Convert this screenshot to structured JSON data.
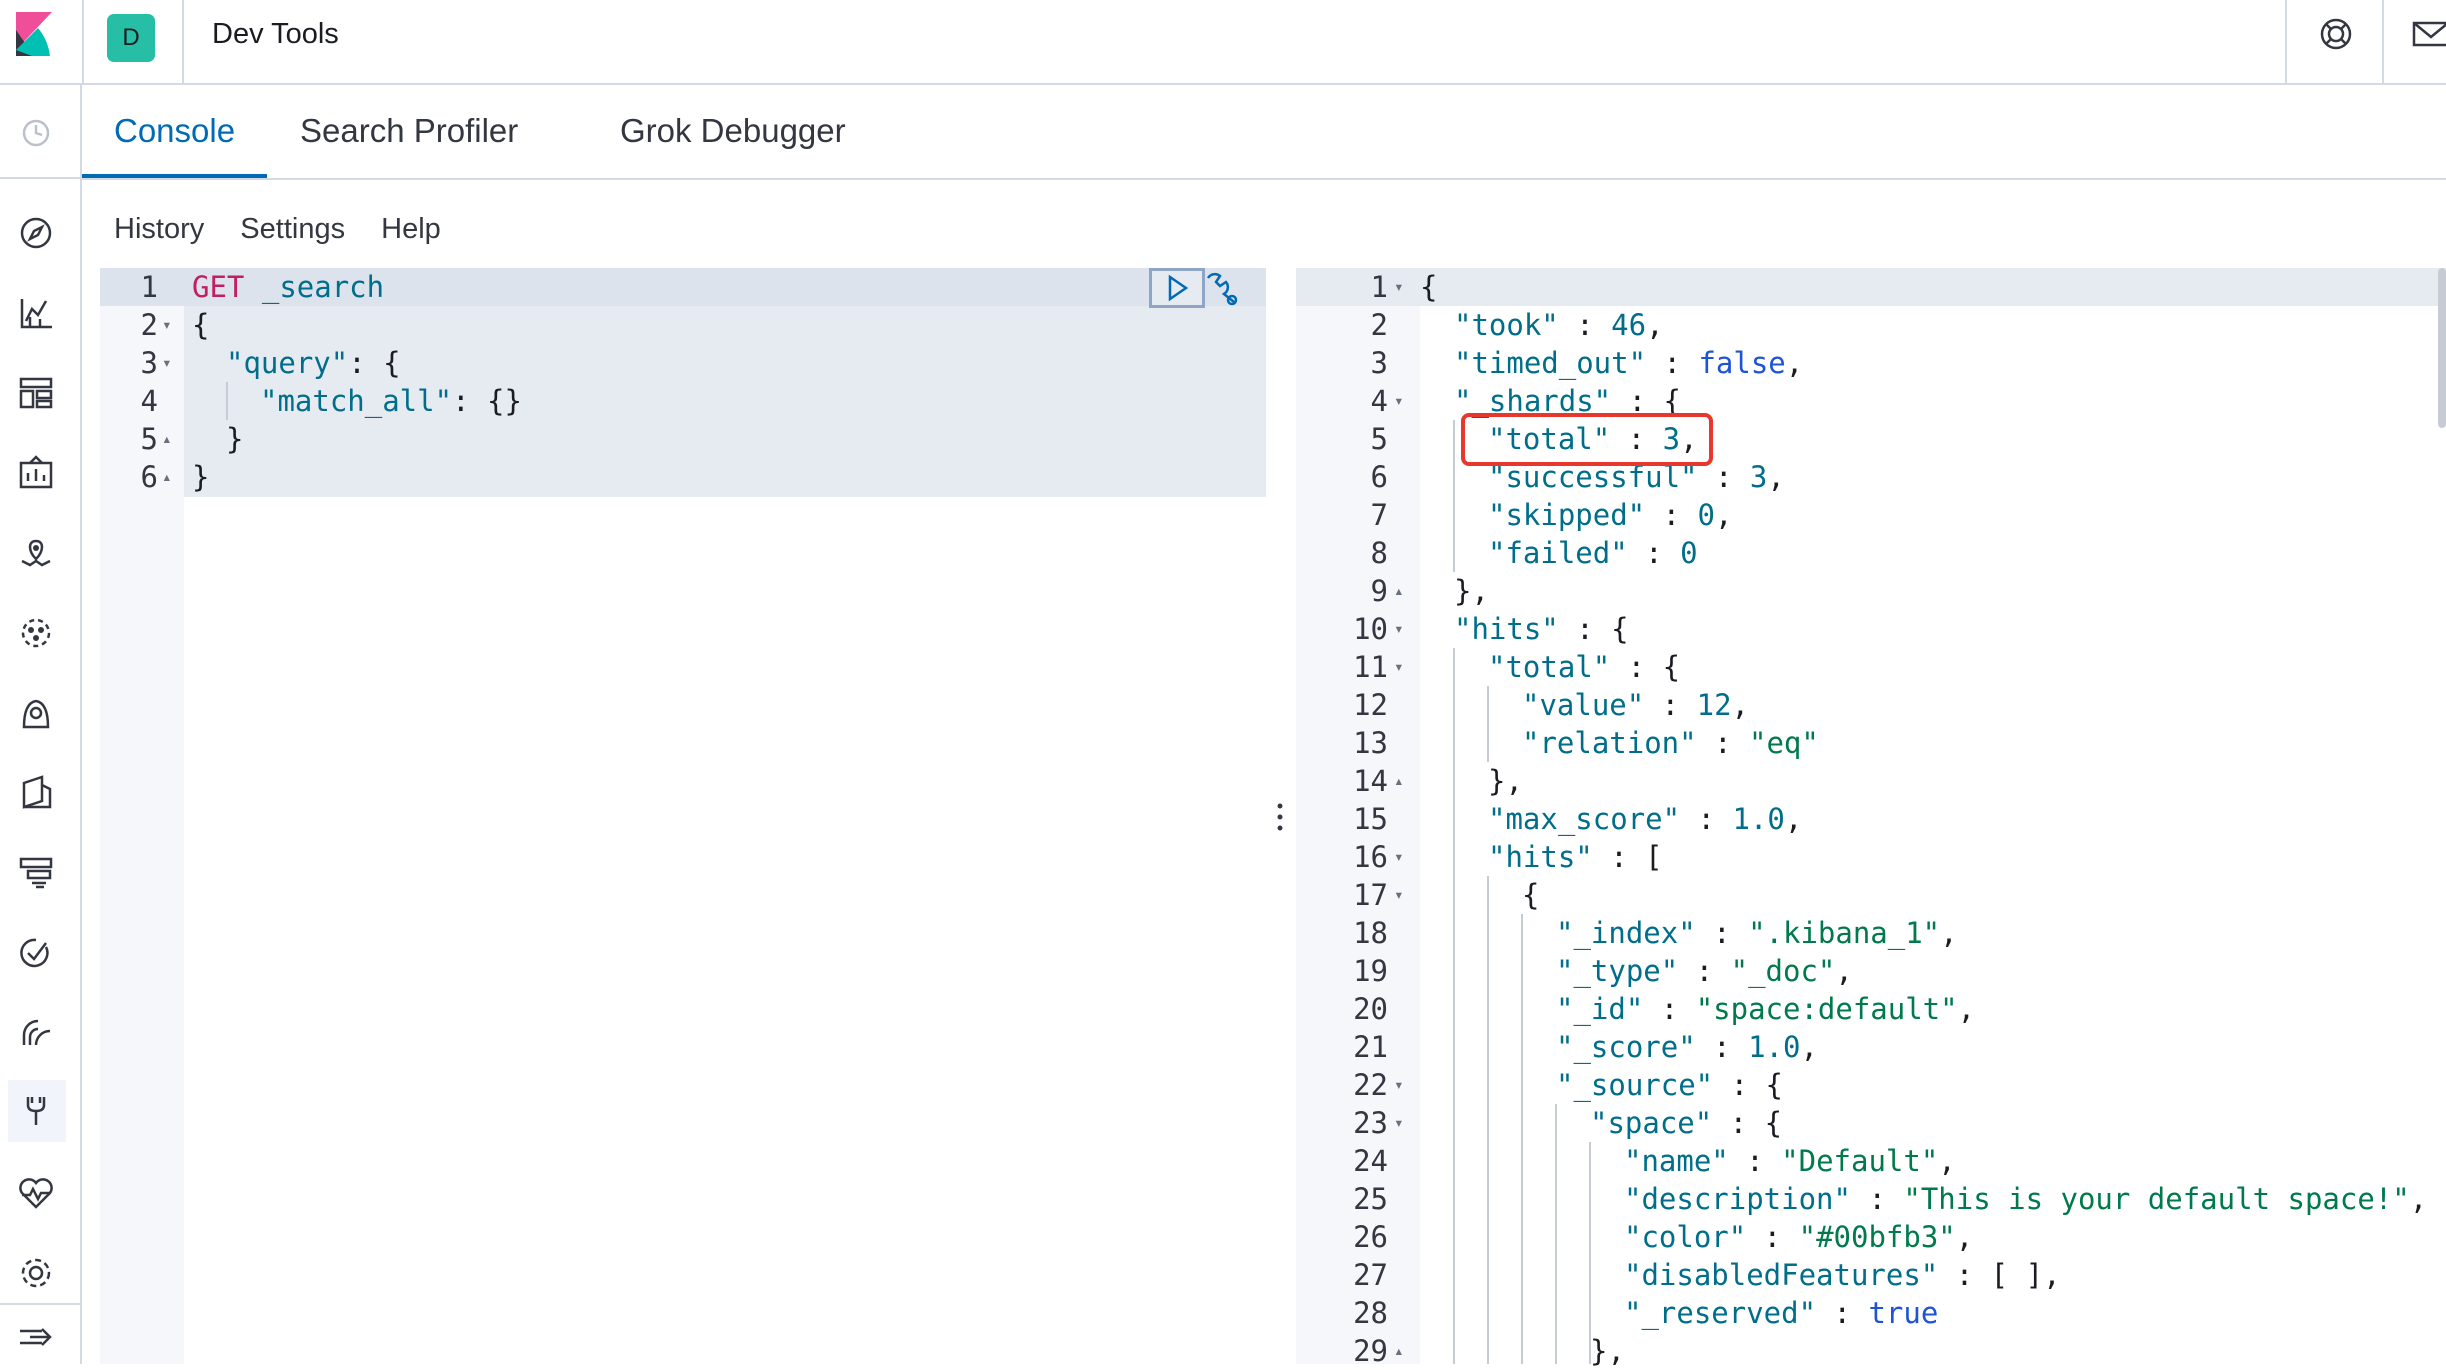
{
  "header": {
    "space_initial": "D",
    "app_title": "Dev Tools"
  },
  "tabs": [
    {
      "label": "Console",
      "active": true
    },
    {
      "label": "Search Profiler",
      "active": false
    },
    {
      "label": "Grok Debugger",
      "active": false
    }
  ],
  "console_menu": [
    "History",
    "Settings",
    "Help"
  ],
  "nav_icons": [
    "recent-icon",
    "discover-icon",
    "visualize-icon",
    "dashboard-icon",
    "canvas-icon",
    "maps-icon",
    "ml-icon",
    "siem-icon",
    "logs-icon",
    "apm-icon",
    "uptime-icon",
    "infrastructure-icon",
    "dev-tools-icon",
    "monitoring-icon",
    "management-icon",
    "collapse-icon"
  ],
  "request": {
    "method": "GET",
    "path": "_search",
    "lines": [
      {
        "n": "1",
        "fold": ""
      },
      {
        "n": "2",
        "fold": "down"
      },
      {
        "n": "3",
        "fold": "down"
      },
      {
        "n": "4",
        "fold": ""
      },
      {
        "n": "5",
        "fold": "up"
      },
      {
        "n": "6",
        "fold": "up"
      }
    ],
    "l2": "{",
    "l3_key": "\"query\"",
    "l3_rest": ": {",
    "l4_key": "\"match_all\"",
    "l4_rest": ": {}",
    "l5": "}",
    "l6": "}"
  },
  "response": {
    "l1": "{",
    "l2k": "\"took\"",
    "l2v": "46",
    "l3k": "\"timed_out\"",
    "l3v": "false",
    "l4k": "\"_shards\"",
    "l5k": "\"total\"",
    "l5v": "3",
    "l6k": "\"successful\"",
    "l6v": "3",
    "l7k": "\"skipped\"",
    "l7v": "0",
    "l8k": "\"failed\"",
    "l8v": "0",
    "l9": "},",
    "l10k": "\"hits\"",
    "l11k": "\"total\"",
    "l12k": "\"value\"",
    "l12v": "12",
    "l13k": "\"relation\"",
    "l13v": "\"eq\"",
    "l14": "},",
    "l15k": "\"max_score\"",
    "l15v": "1.0",
    "l16k": "\"hits\"",
    "l17": "{",
    "l18k": "\"_index\"",
    "l18v": "\".kibana_1\"",
    "l19k": "\"_type\"",
    "l19v": "\"_doc\"",
    "l20k": "\"_id\"",
    "l20v": "\"space:default\"",
    "l21k": "\"_score\"",
    "l21v": "1.0",
    "l22k": "\"_source\"",
    "l23k": "\"space\"",
    "l24k": "\"name\"",
    "l24v": "\"Default\"",
    "l25k": "\"description\"",
    "l25v": "\"This is your default space!\"",
    "l26k": "\"color\"",
    "l26v": "\"#00bfb3\"",
    "l27k": "\"disabledFeatures\"",
    "l27v": "[ ]",
    "l28k": "\"_reserved\"",
    "l28v": "true",
    "l29": "},"
  }
}
